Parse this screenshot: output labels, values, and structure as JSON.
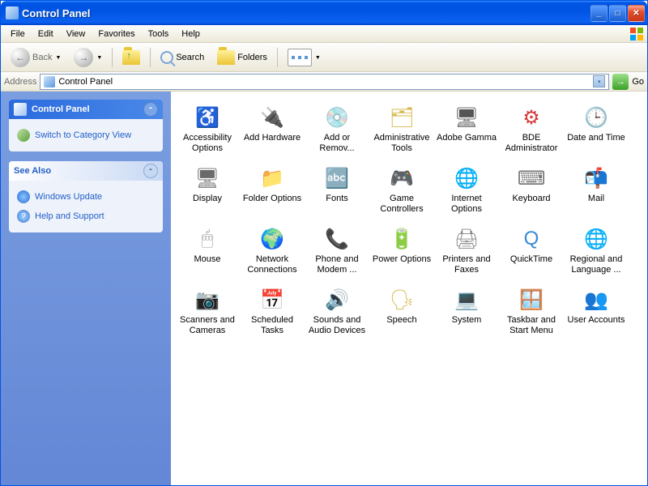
{
  "window": {
    "title": "Control Panel"
  },
  "menu": {
    "items": [
      "File",
      "Edit",
      "View",
      "Favorites",
      "Tools",
      "Help"
    ]
  },
  "toolbar": {
    "back": "Back",
    "search": "Search",
    "folders": "Folders"
  },
  "address": {
    "label": "Address",
    "value": "Control Panel",
    "go": "Go"
  },
  "sidebar": {
    "panel1": {
      "title": "Control Panel",
      "link": "Switch to Category View"
    },
    "panel2": {
      "title": "See Also",
      "links": [
        "Windows Update",
        "Help and Support"
      ]
    }
  },
  "items": [
    {
      "label": "Accessibility Options",
      "icon": "♿",
      "cls": "i-access",
      "name": "accessibility-options"
    },
    {
      "label": "Add Hardware",
      "icon": "🔌",
      "cls": "i-hw",
      "name": "add-hardware"
    },
    {
      "label": "Add or Remov...",
      "icon": "💿",
      "cls": "i-prog",
      "name": "add-remove-programs"
    },
    {
      "label": "Administrative Tools",
      "icon": "🗂",
      "cls": "i-admin",
      "name": "administrative-tools"
    },
    {
      "label": "Adobe Gamma",
      "icon": "🖥",
      "cls": "i-gamma",
      "name": "adobe-gamma"
    },
    {
      "label": "BDE Administrator",
      "icon": "⚙",
      "cls": "i-bde",
      "name": "bde-administrator"
    },
    {
      "label": "Date and Time",
      "icon": "🕒",
      "cls": "i-date",
      "name": "date-and-time"
    },
    {
      "label": "Display",
      "icon": "🖥",
      "cls": "i-display",
      "name": "display"
    },
    {
      "label": "Folder Options",
      "icon": "📁",
      "cls": "i-folder",
      "name": "folder-options"
    },
    {
      "label": "Fonts",
      "icon": "🔤",
      "cls": "i-fonts",
      "name": "fonts"
    },
    {
      "label": "Game Controllers",
      "icon": "🎮",
      "cls": "i-game",
      "name": "game-controllers"
    },
    {
      "label": "Internet Options",
      "icon": "🌐",
      "cls": "i-inet",
      "name": "internet-options"
    },
    {
      "label": "Keyboard",
      "icon": "⌨",
      "cls": "i-kbd",
      "name": "keyboard"
    },
    {
      "label": "Mail",
      "icon": "📬",
      "cls": "i-mail",
      "name": "mail"
    },
    {
      "label": "Mouse",
      "icon": "🖱",
      "cls": "i-mouse",
      "name": "mouse"
    },
    {
      "label": "Network Connections",
      "icon": "🌍",
      "cls": "i-net",
      "name": "network-connections"
    },
    {
      "label": "Phone and Modem ...",
      "icon": "📞",
      "cls": "i-phone",
      "name": "phone-and-modem"
    },
    {
      "label": "Power Options",
      "icon": "🔋",
      "cls": "i-power",
      "name": "power-options"
    },
    {
      "label": "Printers and Faxes",
      "icon": "🖨",
      "cls": "i-print",
      "name": "printers-and-faxes"
    },
    {
      "label": "QuickTime",
      "icon": "Q",
      "cls": "i-qt",
      "name": "quicktime"
    },
    {
      "label": "Regional and Language ...",
      "icon": "🌐",
      "cls": "i-region",
      "name": "regional-and-language"
    },
    {
      "label": "Scanners and Cameras",
      "icon": "📷",
      "cls": "i-scan",
      "name": "scanners-and-cameras"
    },
    {
      "label": "Scheduled Tasks",
      "icon": "📅",
      "cls": "i-sched",
      "name": "scheduled-tasks"
    },
    {
      "label": "Sounds and Audio Devices",
      "icon": "🔊",
      "cls": "i-sound",
      "name": "sounds-and-audio"
    },
    {
      "label": "Speech",
      "icon": "🗣",
      "cls": "i-speech",
      "name": "speech"
    },
    {
      "label": "System",
      "icon": "💻",
      "cls": "i-sys",
      "name": "system"
    },
    {
      "label": "Taskbar and Start Menu",
      "icon": "🪟",
      "cls": "i-taskbar",
      "name": "taskbar-start-menu"
    },
    {
      "label": "User Accounts",
      "icon": "👥",
      "cls": "i-users",
      "name": "user-accounts"
    }
  ]
}
